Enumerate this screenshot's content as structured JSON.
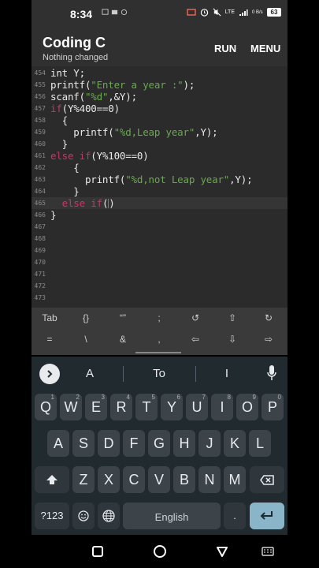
{
  "status_bar": {
    "time": "8:34",
    "notification_icons": [
      "cast-icon",
      "message-icon",
      "photo-icon"
    ],
    "right_icons": [
      "screen-cast-icon",
      "alarm-icon",
      "mute-icon",
      "wifi-icon",
      "signal-icon"
    ],
    "network": "LTE",
    "speed": "0 B/s",
    "battery": "63"
  },
  "app_bar": {
    "title": "Coding C",
    "subtitle": "Nothing changed",
    "run_label": "RUN",
    "menu_label": "MENU"
  },
  "editor": {
    "lines": [
      {
        "num": "454",
        "code": "int Y;"
      },
      {
        "num": "455",
        "code": "printf(\"Enter a year :\");"
      },
      {
        "num": "456",
        "code": "scanf(\"%d\",&Y);"
      },
      {
        "num": "457",
        "code": "if(Y%400==0)"
      },
      {
        "num": "458",
        "code": "  {"
      },
      {
        "num": "459",
        "code": "    printf(\"%d,Leap year\",Y);"
      },
      {
        "num": "460",
        "code": "  }"
      },
      {
        "num": "461",
        "code": "else if(Y%100==0)"
      },
      {
        "num": "462",
        "code": "    {"
      },
      {
        "num": "463",
        "code": "      printf(\"%d,not Leap year\",Y);"
      },
      {
        "num": "464",
        "code": "    }"
      },
      {
        "num": "465",
        "code": "  else if()"
      },
      {
        "num": "466",
        "code": "}"
      },
      {
        "num": "467",
        "code": ""
      },
      {
        "num": "468",
        "code": ""
      },
      {
        "num": "469",
        "code": ""
      },
      {
        "num": "470",
        "code": ""
      },
      {
        "num": "471",
        "code": ""
      },
      {
        "num": "472",
        "code": ""
      },
      {
        "num": "473",
        "code": ""
      }
    ]
  },
  "extra_keys": {
    "row1": [
      "Tab",
      "{}",
      "“”",
      ";",
      "↺",
      "⇧",
      "↻"
    ],
    "row2": [
      "=",
      "\\",
      "&",
      ",",
      "⇦",
      "⇩",
      "⇨"
    ]
  },
  "keyboard": {
    "suggestions": [
      "A",
      "To",
      "I"
    ],
    "row1": [
      {
        "k": "Q",
        "h": "1"
      },
      {
        "k": "W",
        "h": "2"
      },
      {
        "k": "E",
        "h": "3"
      },
      {
        "k": "R",
        "h": "4"
      },
      {
        "k": "T",
        "h": "5"
      },
      {
        "k": "Y",
        "h": "6"
      },
      {
        "k": "U",
        "h": "7"
      },
      {
        "k": "I",
        "h": "8"
      },
      {
        "k": "O",
        "h": "9"
      },
      {
        "k": "P",
        "h": "0"
      }
    ],
    "row2": [
      "A",
      "S",
      "D",
      "F",
      "G",
      "H",
      "J",
      "K",
      "L"
    ],
    "row3": [
      "Z",
      "X",
      "C",
      "V",
      "B",
      "N",
      "M"
    ],
    "symbols_label": "?123",
    "space_label": "English",
    "period_label": "."
  }
}
